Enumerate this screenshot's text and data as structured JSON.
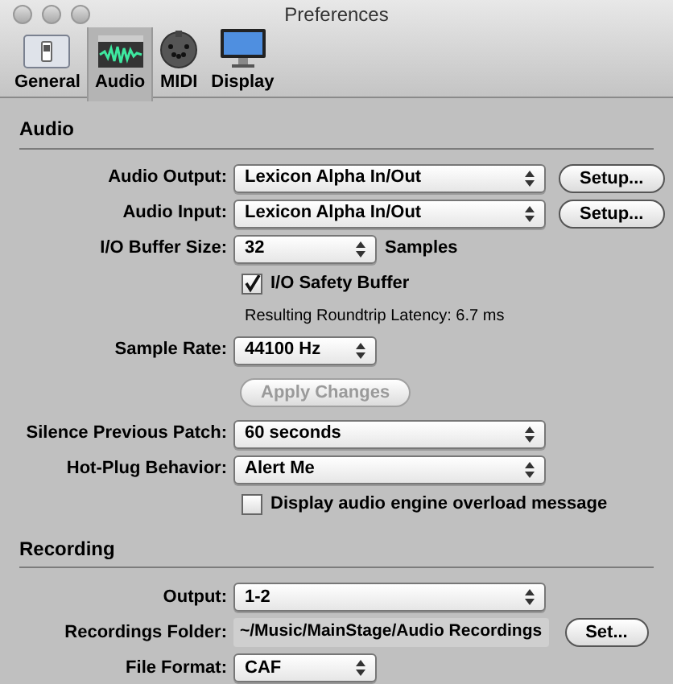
{
  "window": {
    "title": "Preferences"
  },
  "tabs": [
    {
      "label": "General",
      "selected": false
    },
    {
      "label": "Audio",
      "selected": true
    },
    {
      "label": "MIDI",
      "selected": false
    },
    {
      "label": "Display",
      "selected": false
    }
  ],
  "sections": [
    {
      "title": "Audio",
      "rows": [
        {
          "kind": "popup",
          "label": "Audio Output:",
          "value": "Lexicon Alpha In/Out",
          "button": "Setup..."
        },
        {
          "kind": "popup",
          "label": "Audio Input:",
          "value": "Lexicon Alpha In/Out",
          "button": "Setup..."
        },
        {
          "kind": "minipopup",
          "label": "I/O Buffer Size:",
          "value": "32",
          "suffix": "Samples"
        },
        {
          "kind": "checkbox",
          "label": "I/O Safety Buffer",
          "checked": true
        },
        {
          "kind": "note",
          "text": "Resulting Roundtrip Latency: 6.7 ms"
        },
        {
          "kind": "minipopup",
          "label": "Sample Rate:",
          "value": "44100 Hz"
        },
        {
          "kind": "button",
          "label": "Apply Changes",
          "disabled": true
        },
        {
          "kind": "popup",
          "label": "Silence Previous Patch:",
          "value": "60 seconds"
        },
        {
          "kind": "popup",
          "label": "Hot-Plug Behavior:",
          "value": "Alert Me"
        },
        {
          "kind": "checkbox",
          "label": "Display audio engine overload message",
          "checked": false
        }
      ]
    },
    {
      "title": "Recording",
      "rows": [
        {
          "kind": "popup",
          "label": "Output:",
          "value": "1-2"
        },
        {
          "kind": "path",
          "label": "Recordings Folder:",
          "value": "~/Music/MainStage/Audio Recordings",
          "button": "Set..."
        },
        {
          "kind": "minipopup",
          "label": "File Format:",
          "value": "CAF"
        }
      ]
    }
  ]
}
